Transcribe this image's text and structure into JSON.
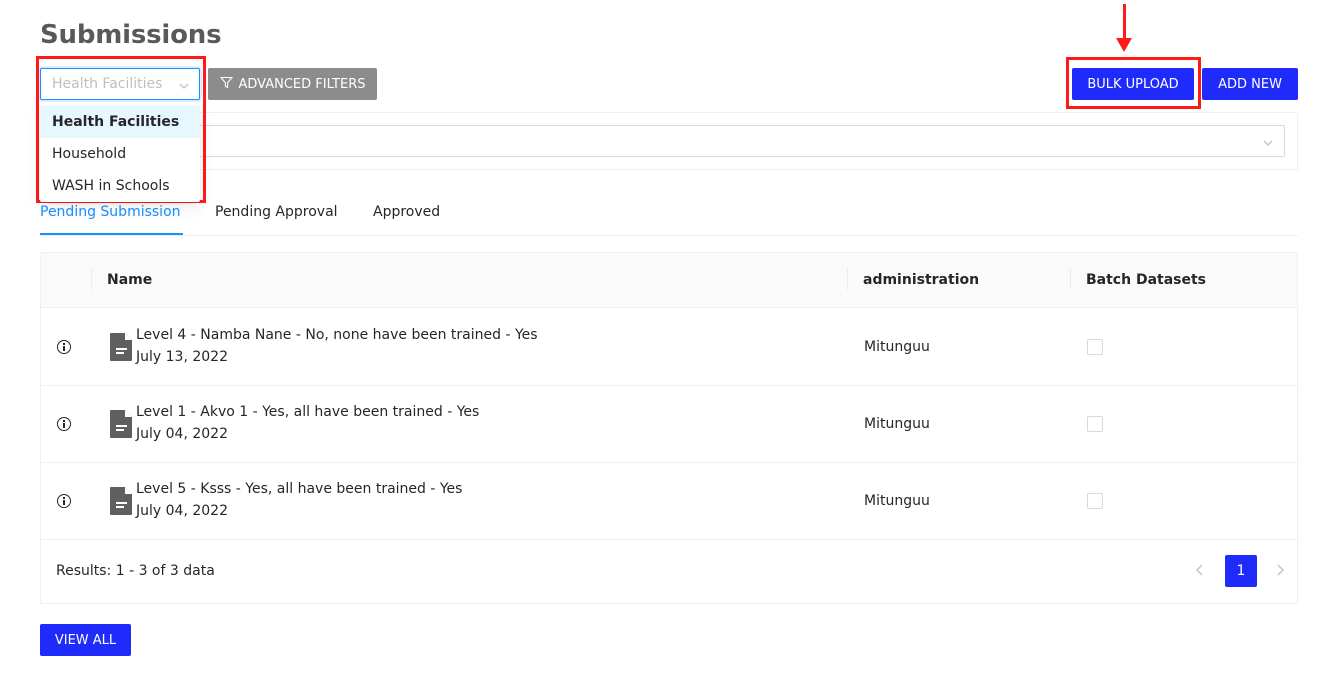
{
  "page": {
    "title": "Submissions"
  },
  "toolbar": {
    "form_select_value": "Health Facilities",
    "advanced_filters_label": "ADVANCED FILTERS",
    "bulk_upload_label": "BULK UPLOAD",
    "add_new_label": "ADD NEW"
  },
  "form_dropdown": {
    "options": [
      "Health Facilities",
      "Household",
      "WASH in Schools"
    ],
    "selected": "Health Facilities"
  },
  "tabs": [
    {
      "label": "Pending Submission",
      "active": true
    },
    {
      "label": "Pending Approval",
      "active": false
    },
    {
      "label": "Approved",
      "active": false
    }
  ],
  "table": {
    "columns": [
      "Name",
      "administration",
      "Batch Datasets"
    ],
    "rows": [
      {
        "name": "Level 4 - Namba Nane - No, none have been trained - Yes",
        "date": "July 13, 2022",
        "administration": "Mitunguu",
        "batch": false
      },
      {
        "name": "Level 1 - Akvo 1 - Yes, all have been trained - Yes",
        "date": "July 04, 2022",
        "administration": "Mitunguu",
        "batch": false
      },
      {
        "name": "Level 5 - Ksss - Yes, all have been trained - Yes",
        "date": "July 04, 2022",
        "administration": "Mitunguu",
        "batch": false
      }
    ],
    "results_text": "Results: 1 - 3 of 3 data",
    "current_page": "1"
  },
  "footer": {
    "view_all_label": "VIEW ALL"
  },
  "colors": {
    "primary": "#1f2bfb",
    "link": "#1890ff",
    "annotation": "#ff1a1a",
    "muted_button": "#8c8c8c"
  },
  "icons": [
    "chevron-down-icon",
    "filter-icon",
    "info-icon",
    "document-icon",
    "arrow-down-icon"
  ]
}
